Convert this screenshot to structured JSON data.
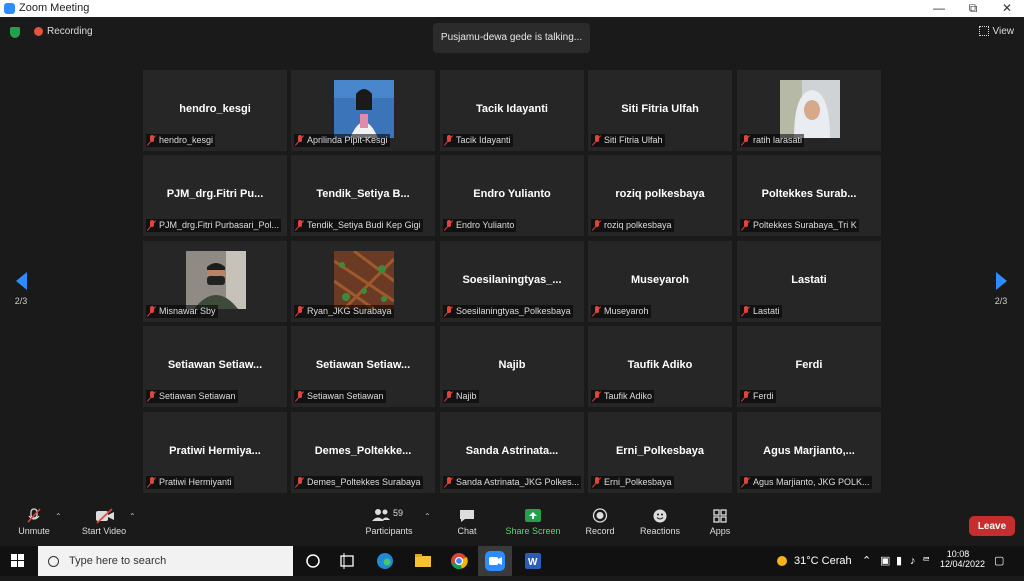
{
  "window": {
    "title": "Zoom Meeting"
  },
  "topbar": {
    "recording_label": "Recording",
    "talking_text": "Pusjamu-dewa gede is talking...",
    "view_label": "View"
  },
  "pager": {
    "left_label": "2/3",
    "right_label": "2/3"
  },
  "tiles": [
    {
      "big": "hendro_kesgi",
      "label": "hendro_kesgi"
    },
    {
      "big": "",
      "label": "Aprilinda Pipit-Kesgi",
      "photo": "photo-woman-presenter"
    },
    {
      "big": "Tacik Idayanti",
      "label": "Tacik Idayanti"
    },
    {
      "big": "Siti Fitria Ulfah",
      "label": "Siti Fitria Ulfah"
    },
    {
      "big": "",
      "label": "ratih larasati",
      "photo": "photo-woman-hijab"
    },
    {
      "big": "PJM_drg.Fitri  Pu...",
      "label": "PJM_drg.Fitri Purbasari_Pol..."
    },
    {
      "big": "Tendik_Setiya  B...",
      "label": "Tendik_Setiya Budi Kep Gigi"
    },
    {
      "big": "Endro Yulianto",
      "label": "Endro Yulianto"
    },
    {
      "big": "roziq polkesbaya",
      "label": "roziq polkesbaya"
    },
    {
      "big": "Poltekkes  Surab...",
      "label": "Poltekkes Surabaya_Tri K"
    },
    {
      "big": "",
      "label": "Misnawar Sby",
      "photo": "photo-man-mask"
    },
    {
      "big": "",
      "label": "Ryan_JKG Surabaya",
      "photo": "photo-leaves"
    },
    {
      "big": "Soesilaningtyas_...",
      "label": "Soesilaningtyas_Polkesbaya"
    },
    {
      "big": "Museyaroh",
      "label": "Museyaroh"
    },
    {
      "big": "Lastati",
      "label": "Lastati"
    },
    {
      "big": "Setiawan  Setiaw...",
      "label": "Setiawan Setiawan"
    },
    {
      "big": "Setiawan  Setiaw...",
      "label": "Setiawan Setiawan"
    },
    {
      "big": "Najib",
      "label": "Najib"
    },
    {
      "big": "Taufik Adiko",
      "label": "Taufik Adiko"
    },
    {
      "big": "Ferdi",
      "label": "Ferdi"
    },
    {
      "big": "Pratiwi  Hermiya...",
      "label": "Pratiwi Hermiyanti"
    },
    {
      "big": "Demes_Poltekke...",
      "label": "Demes_Poltekkes Surabaya"
    },
    {
      "big": "Sanda  Astrinata...",
      "label": "Sanda Astrinata_JKG Polkes..."
    },
    {
      "big": "Erni_Polkesbaya",
      "label": "Erni_Polkesbaya"
    },
    {
      "big": "Agus  Marjianto,...",
      "label": "Agus Marjianto, JKG POLK..."
    }
  ],
  "toolbar": {
    "unmute": "Unmute",
    "start_video": "Start Video",
    "participants": "Participants",
    "participants_count": "59",
    "chat": "Chat",
    "share_screen": "Share Screen",
    "record": "Record",
    "reactions": "Reactions",
    "apps": "Apps",
    "leave": "Leave"
  },
  "taskbar": {
    "search_placeholder": "Type here to search",
    "weather": "31°C  Cerah",
    "time": "10:08",
    "date": "12/04/2022"
  },
  "colors": {
    "accent": "#2d8cff",
    "leave": "#c62d2d",
    "share": "#23a04a",
    "muted_mic": "#e0453a"
  }
}
